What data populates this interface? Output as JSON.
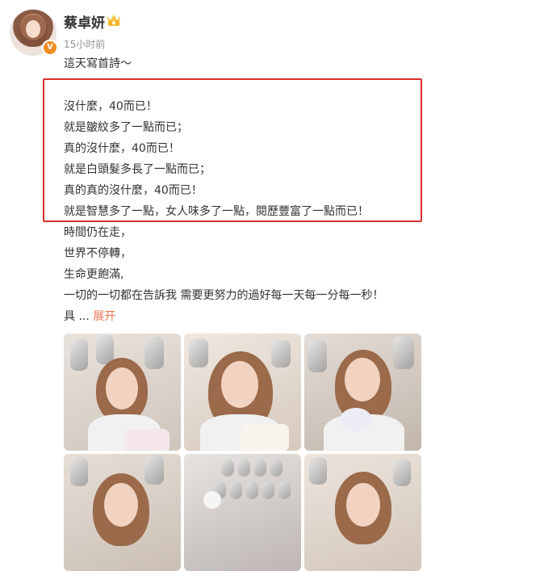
{
  "post": {
    "username": "蔡卓妍",
    "timestamp": "15小时前",
    "intro": "這天寫首詩～",
    "highlighted_lines": [
      "沒什麼，40而已！",
      "就是皺紋多了一點而已；",
      "真的沒什麼，40而已！",
      "就是白頭髮多長了一點而已；",
      "真的真的沒什麼，40而已！",
      "就是智慧多了一點，女人味多了一點，閱歷豐富了一點而已！"
    ],
    "more_lines": [
      "時間仍在走，",
      "世界不停轉，",
      "生命更飽滿,",
      "一切的一切都在告訴我 需要更努力的過好每一天每一分每一秒！"
    ],
    "truncated_text": "具  ...",
    "expand_label": "展开",
    "verified_badge": "V",
    "crown_icon": "crown-icon",
    "colors": {
      "highlight_border": "#d9312e",
      "link": "#eb7350",
      "meta": "#939393",
      "badge": "#f28b22"
    }
  }
}
